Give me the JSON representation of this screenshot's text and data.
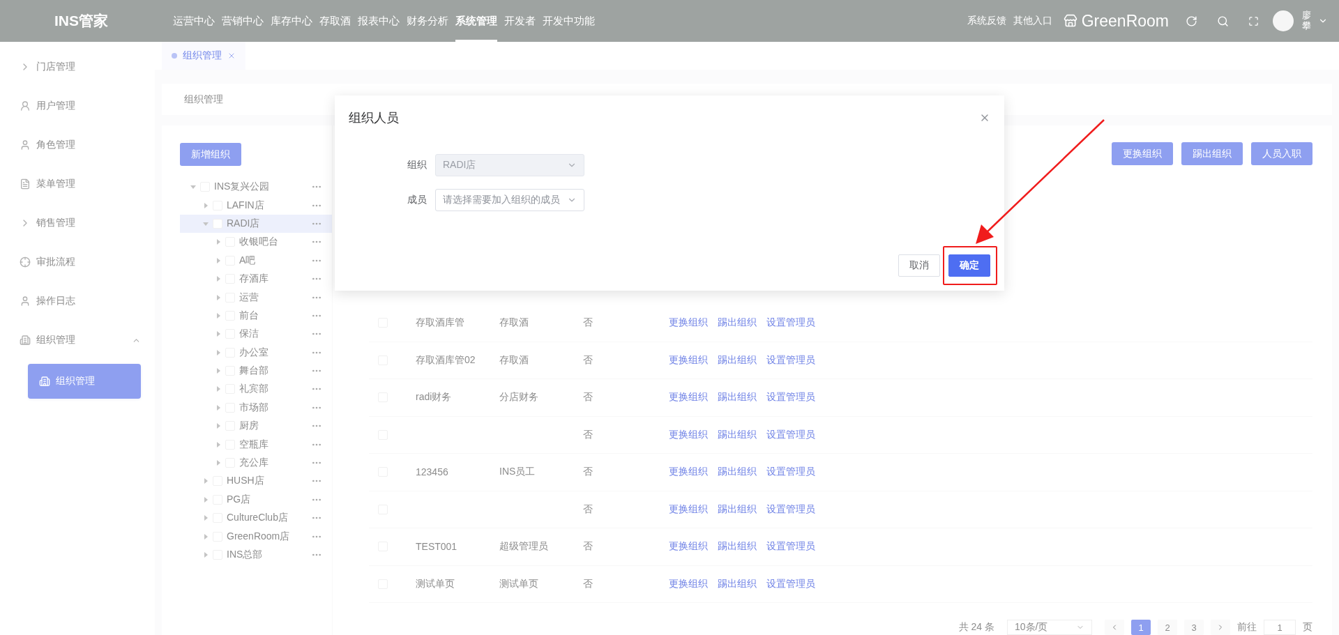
{
  "header": {
    "logo": "INS管家",
    "nav": [
      {
        "label": "运营中心",
        "selected": false
      },
      {
        "label": "营销中心",
        "selected": false
      },
      {
        "label": "库存中心",
        "selected": false
      },
      {
        "label": "存取酒",
        "selected": false
      },
      {
        "label": "报表中心",
        "selected": false
      },
      {
        "label": "财务分析",
        "selected": false
      },
      {
        "label": "系统管理",
        "selected": true
      },
      {
        "label": "开发者",
        "selected": false
      },
      {
        "label": "开发中功能",
        "selected": false
      }
    ],
    "links": [
      "系统反馈",
      "其他入口"
    ],
    "store": "GreenRoom",
    "user": "廖攀"
  },
  "sidebar": {
    "items": [
      {
        "label": "门店管理"
      },
      {
        "label": "用户管理"
      },
      {
        "label": "角色管理"
      },
      {
        "label": "菜单管理"
      },
      {
        "label": "销售管理"
      },
      {
        "label": "审批流程"
      },
      {
        "label": "操作日志"
      },
      {
        "label": "组织管理",
        "expanded": true,
        "children": [
          {
            "label": "组织管理",
            "selected": true
          }
        ]
      }
    ]
  },
  "tabs": [
    {
      "label": "组织管理",
      "selected": true
    }
  ],
  "page_title": "组织管理",
  "tree": {
    "add_button": "新增组织",
    "nodes": [
      {
        "label": "INS复兴公园",
        "expanded": true,
        "selected": false,
        "checked": false,
        "children": [
          {
            "label": "LAFIN店",
            "expanded": false,
            "selected": false,
            "checked": false
          },
          {
            "label": "RADI店",
            "expanded": true,
            "selected": true,
            "checked": false,
            "children": [
              {
                "label": "收银吧台",
                "expanded": false,
                "selected": false,
                "checked": false
              },
              {
                "label": "A吧",
                "expanded": false,
                "selected": false,
                "checked": false
              },
              {
                "label": "存酒库",
                "expanded": false,
                "selected": false,
                "checked": false
              },
              {
                "label": "运营",
                "expanded": false,
                "selected": false,
                "checked": false
              },
              {
                "label": "前台",
                "expanded": false,
                "selected": false,
                "checked": false
              },
              {
                "label": "保洁",
                "expanded": false,
                "selected": false,
                "checked": false
              },
              {
                "label": "办公室",
                "expanded": false,
                "selected": false,
                "checked": false
              },
              {
                "label": "舞台部",
                "expanded": false,
                "selected": false,
                "checked": false
              },
              {
                "label": "礼宾部",
                "expanded": false,
                "selected": false,
                "checked": false
              },
              {
                "label": "市场部",
                "expanded": false,
                "selected": false,
                "checked": false
              },
              {
                "label": "厨房",
                "expanded": false,
                "selected": false,
                "checked": false
              },
              {
                "label": "空瓶库",
                "expanded": false,
                "selected": false,
                "checked": false
              },
              {
                "label": "充公库",
                "expanded": false,
                "selected": false,
                "checked": false
              }
            ]
          },
          {
            "label": "HUSH店",
            "expanded": false,
            "selected": false,
            "checked": false
          },
          {
            "label": "PG店",
            "expanded": false,
            "selected": false,
            "checked": false
          },
          {
            "label": "CultureClub店",
            "expanded": false,
            "selected": false,
            "checked": false
          },
          {
            "label": "GreenRoom店",
            "expanded": false,
            "selected": false,
            "checked": false
          },
          {
            "label": "INS总部",
            "expanded": false,
            "selected": false,
            "checked": false
          }
        ]
      }
    ]
  },
  "toolbar": [
    "更换组织",
    "踢出组织",
    "人员入职"
  ],
  "table": {
    "rows": [
      {
        "checked": false,
        "name": "存取酒库管",
        "role": "存取酒",
        "admin": "否",
        "actions": [
          "更换组织",
          "踢出组织",
          "设置管理员"
        ]
      },
      {
        "checked": false,
        "name": "存取酒库管02",
        "role": "存取酒",
        "admin": "否",
        "actions": [
          "更换组织",
          "踢出组织",
          "设置管理员"
        ]
      },
      {
        "checked": false,
        "name": "radi财务",
        "role": "分店财务",
        "admin": "否",
        "actions": [
          "更换组织",
          "踢出组织",
          "设置管理员"
        ]
      },
      {
        "checked": false,
        "admin": "否",
        "actions": [
          "更换组织",
          "踢出组织",
          "设置管理员"
        ]
      },
      {
        "checked": false,
        "name": "123456",
        "role": "INS员工",
        "admin": "否",
        "actions": [
          "更换组织",
          "踢出组织",
          "设置管理员"
        ]
      },
      {
        "checked": false,
        "admin": "否",
        "actions": [
          "更换组织",
          "踢出组织",
          "设置管理员"
        ]
      },
      {
        "checked": false,
        "name": "TEST001",
        "role": "超级管理员",
        "admin": "否",
        "actions": [
          "更换组织",
          "踢出组织",
          "设置管理员"
        ]
      },
      {
        "checked": false,
        "name": "测试单页",
        "role": "测试单页",
        "admin": "否",
        "actions": [
          "更换组织",
          "踢出组织",
          "设置管理员"
        ]
      }
    ]
  },
  "pagination": {
    "total": "共 24 条",
    "page_size": "10条/页",
    "pages": [
      {
        "label": "1",
        "selected": true
      },
      {
        "label": "2",
        "selected": false
      },
      {
        "label": "3",
        "selected": false
      }
    ],
    "goto_label": "前往",
    "goto_value": "1",
    "page_suffix": "页"
  },
  "dialog": {
    "title": "组织人员",
    "fields": [
      {
        "label": "组织",
        "value": "RADI店",
        "disabled": true
      },
      {
        "label": "成员",
        "placeholder": "请选择需要加入组织的成员",
        "disabled": false
      }
    ],
    "buttons": [
      {
        "label": "取消",
        "kind": "default",
        "annotated": false
      },
      {
        "label": "确定",
        "kind": "primary",
        "annotated": true
      }
    ]
  }
}
